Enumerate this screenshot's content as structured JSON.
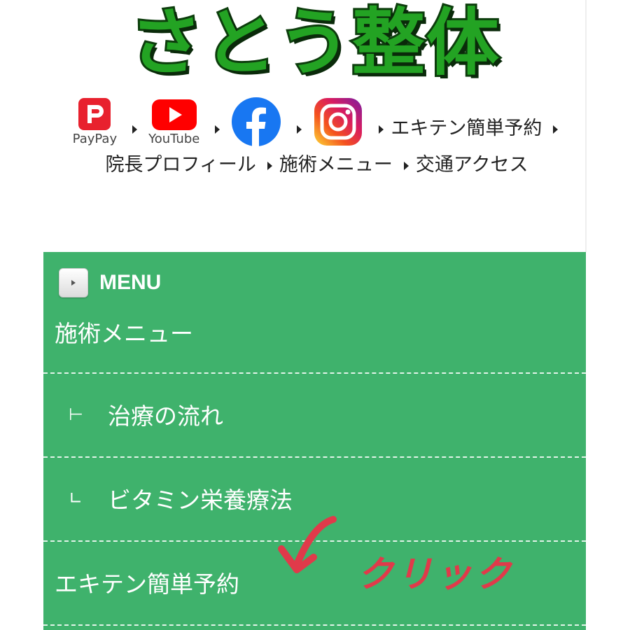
{
  "header": {
    "logo_text": "さとう整体"
  },
  "links": {
    "sns": [
      {
        "name": "paypay",
        "caption": "PayPay"
      },
      {
        "name": "youtube",
        "caption": "YouTube"
      },
      {
        "name": "facebook",
        "caption": ""
      },
      {
        "name": "instagram",
        "caption": ""
      }
    ],
    "text_links": [
      "エキテン簡単予約",
      "院長プロフィール",
      "施術メニュー",
      "交通アクセス"
    ]
  },
  "menu": {
    "title": "MENU",
    "items": [
      {
        "label": "施術メニュー",
        "level": 0
      },
      {
        "label": "治療の流れ",
        "level": 1,
        "mark": "⊢"
      },
      {
        "label": "ビタミン栄養療法",
        "level": 1,
        "mark": "∟"
      },
      {
        "label": "エキテン簡単予約",
        "level": 0
      }
    ]
  },
  "annotation": {
    "text": "クリック",
    "color": "#e03a4a"
  },
  "colors": {
    "logo_green": "#23a323",
    "menu_bg": "#3fb26c",
    "paypay_red": "#e8212e",
    "youtube_red": "#ff0000",
    "facebook_blue": "#1877f2"
  }
}
